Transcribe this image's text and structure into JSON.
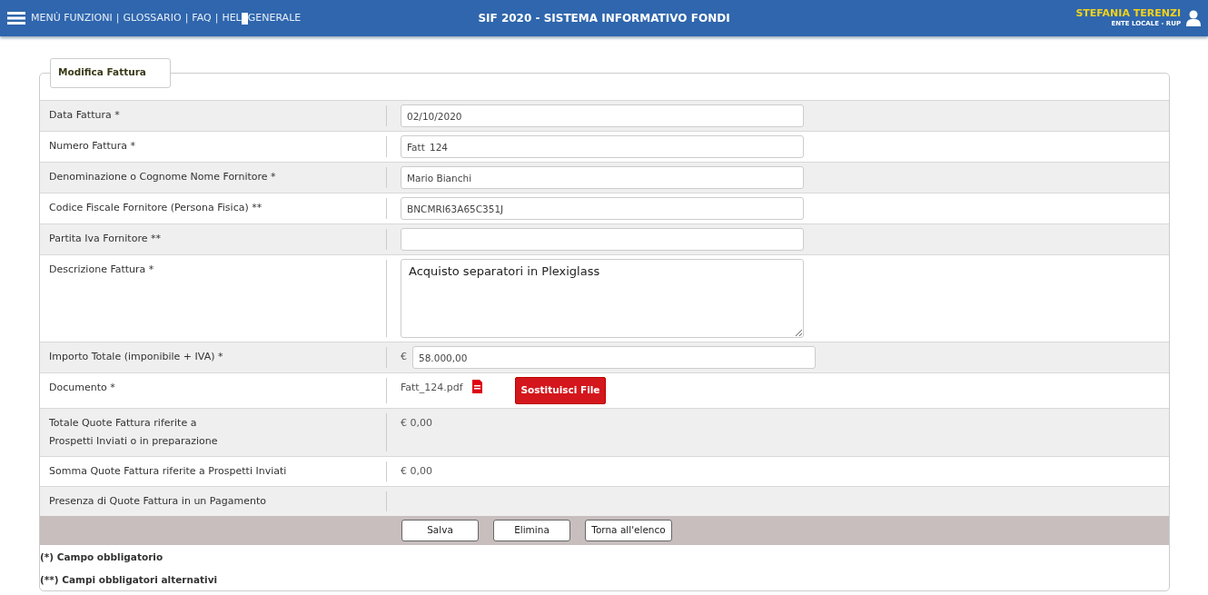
{
  "header": {
    "nav": [
      {
        "text": "MENÙ FUNZIONI"
      },
      {
        "text": "GLOSSARIO"
      },
      {
        "text": "FAQ"
      },
      {
        "text": "HEL",
        "text_after_cursor": "GENERALE"
      }
    ],
    "nav_separator": "|",
    "title": "SIF 2020 - SISTEMA INFORMATIVO FONDI",
    "user": {
      "name": "STEFANIA TERENZI",
      "role": "ENTE LOCALE - RUP"
    }
  },
  "form": {
    "title": "Modifica Fattura",
    "rows": [
      {
        "kind": "input",
        "label": "Data Fattura *",
        "value": "02/10/2020"
      },
      {
        "kind": "input",
        "label": "Numero Fattura *",
        "value": "Fatt_124"
      },
      {
        "kind": "input",
        "label": "Denominazione o Cognome Nome Fornitore *",
        "value": "Mario Bianchi"
      },
      {
        "kind": "input",
        "label": "Codice Fiscale Fornitore (Persona Fisica) **",
        "value": "BNCMRI63A65C351J"
      },
      {
        "kind": "input",
        "label": "Partita Iva Fornitore **"
      },
      {
        "kind": "textarea",
        "label": "Descrizione Fattura *",
        "value": "Acquisto separatori in Plexiglass"
      },
      {
        "kind": "amount",
        "label": "Importo Totale (imponibile + IVA) *",
        "currency": "€",
        "value": "58.000,00"
      },
      {
        "kind": "document",
        "label": "Documento *",
        "file": "Fatt_124.pdf",
        "button": "Sostituisci File"
      },
      {
        "kind": "text",
        "label_lines": [
          "Totale Quote Fattura riferite a",
          "Prospetti Inviati o in preparazione"
        ],
        "value": "€ 0,00"
      },
      {
        "kind": "text",
        "label": "Somma Quote Fattura riferite a Prospetti Inviati",
        "value": "€ 0,00"
      },
      {
        "kind": "text",
        "label": "Presenza di Quote Fattura in un Pagamento"
      }
    ],
    "buttons": [
      "Salva",
      "Elimina",
      "Torna all'elenco"
    ],
    "notes": [
      "(*) Campo obbligatorio",
      "(**) Campi obbligatori alternativi"
    ]
  }
}
